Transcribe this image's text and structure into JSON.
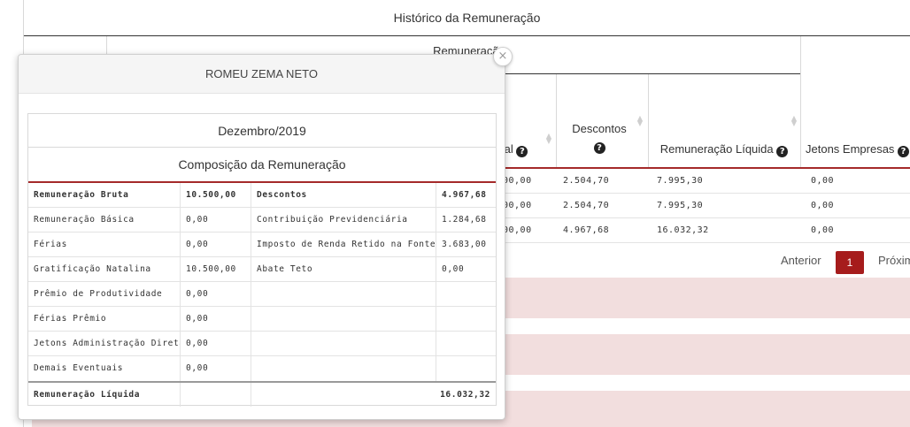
{
  "background": {
    "history_title": "Histórico da Remuneração",
    "group_header": "Remuneração",
    "columns": {
      "total_partial": "tal",
      "descontos": "Descontos",
      "liquida": "Remuneração Líquida",
      "jetons": "Jetons Empresas"
    },
    "rows": [
      {
        "total": "00,00",
        "descontos": "2.504,70",
        "liquida": "7.995,30",
        "jetons": "0,00"
      },
      {
        "total": "00,00",
        "descontos": "2.504,70",
        "liquida": "7.995,30",
        "jetons": "0,00"
      },
      {
        "total": "00,00",
        "descontos": "4.967,68",
        "liquida": "16.032,32",
        "jetons": "0,00"
      }
    ],
    "pagination": {
      "previous": "Anterior",
      "current": "1",
      "next": "Próxim"
    },
    "colors": {
      "accent": "#a61c1c",
      "band": "#f2dede"
    }
  },
  "modal": {
    "title": "ROMEU ZEMA NETO",
    "close_symbol": "×",
    "period": "Dezembro/2019",
    "composition_title": "Composição da Remuneração",
    "rows": [
      {
        "label": "Remuneração Bruta",
        "value": "10.500,00",
        "disc_label": "Descontos",
        "disc_value": "4.967,68",
        "bold": true
      },
      {
        "label": "Remuneração Básica",
        "value": "0,00",
        "disc_label": "Contribuição Previdenciária",
        "disc_value": "1.284,68"
      },
      {
        "label": "Férias",
        "value": "0,00",
        "disc_label": "Imposto de Renda Retido na Fonte",
        "disc_value": "3.683,00"
      },
      {
        "label": "Gratificação Natalina",
        "value": "10.500,00",
        "disc_label": "Abate Teto",
        "disc_value": "0,00"
      },
      {
        "label": "Prêmio de Produtividade",
        "value": "0,00",
        "disc_label": "",
        "disc_value": ""
      },
      {
        "label": "Férias Prêmio",
        "value": "0,00",
        "disc_label": "",
        "disc_value": ""
      },
      {
        "label": "Jetons Administração Direta",
        "value": "0,00",
        "disc_label": "",
        "disc_value": ""
      },
      {
        "label": "Demais Eventuais",
        "value": "0,00",
        "disc_label": "",
        "disc_value": ""
      }
    ],
    "total": {
      "label": "Remuneração Líquida",
      "value": "16.032,32"
    }
  }
}
